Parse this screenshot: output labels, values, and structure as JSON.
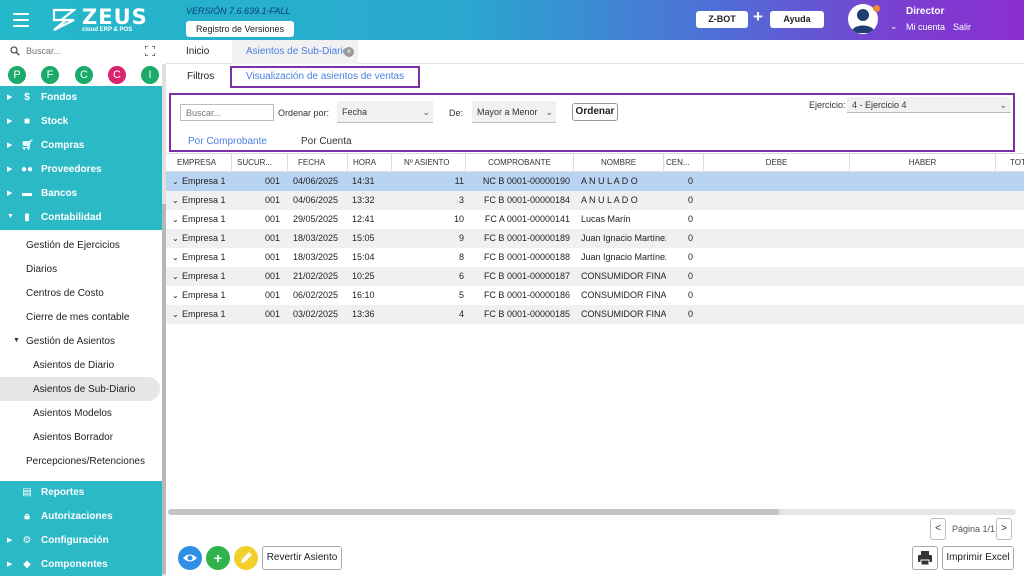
{
  "header": {
    "logo_text": "ZEUS",
    "logo_sub": "cloud ERP & POS",
    "version": "VERSIÓN 7.6.639.1-FALL",
    "registro_label": "Registro de Versiones",
    "zbot_label": "Z-BOT",
    "plus": "+",
    "ayuda_label": "Ayuda",
    "user_name": "Director",
    "mi_cuenta": "Mi cuenta",
    "salir": "Salir"
  },
  "sidebar": {
    "search_placeholder": "Buscar...",
    "quick": [
      {
        "letter": "P",
        "color": "#1aaa6a"
      },
      {
        "letter": "F",
        "color": "#1aaa6a"
      },
      {
        "letter": "C",
        "color": "#1aaa6a"
      },
      {
        "letter": "C",
        "color": "#d9236e"
      },
      {
        "letter": "I",
        "color": "#1aaa6a"
      }
    ],
    "nav_top": [
      {
        "label": "Fondos",
        "icon": "dollar-icon"
      },
      {
        "label": "Stock",
        "icon": "box-icon"
      },
      {
        "label": "Compras",
        "icon": "cart-icon"
      },
      {
        "label": "Proveedores",
        "icon": "people-icon"
      },
      {
        "label": "Bancos",
        "icon": "bank-icon"
      },
      {
        "label": "Contabilidad",
        "icon": "book-icon"
      }
    ],
    "sub_items": [
      "Gestión de Ejercicios",
      "Diarios",
      "Centros de Costo",
      "Cierre de mes contable",
      "Gestión de Asientos",
      "Asientos de Diario",
      "Asientos de Sub-Diario",
      "Asientos Modelos",
      "Asientos Borrador",
      "Percepciones/Retenciones"
    ],
    "nav_bottom": [
      {
        "label": "Reportes",
        "icon": "report-icon"
      },
      {
        "label": "Autorizaciones",
        "icon": "lock-icon"
      },
      {
        "label": "Configuración",
        "icon": "gear-icon"
      },
      {
        "label": "Componentes",
        "icon": "component-icon"
      }
    ]
  },
  "tabs": {
    "inicio": "Inicio",
    "asientos": "Asientos de Sub-Diario"
  },
  "subtabs": {
    "filtros": "Filtros",
    "visualizacion": "Visualización de asientos de ventas"
  },
  "filters": {
    "search_placeholder": "Buscar...",
    "ordenar_por_label": "Ordenar por:",
    "ordenar_por_value": "Fecha",
    "de_label": "De:",
    "de_value": "Mayor a Menor",
    "ordenar_button": "Ordenar",
    "ejercicio_label": "Ejercicio:",
    "ejercicio_value": "4 - Ejercicio 4",
    "view_comprobante": "Por Comprobante",
    "view_cuenta": "Por Cuenta"
  },
  "table": {
    "headers": [
      "EMPRESA",
      "SUCUR...",
      "FECHA",
      "HORA",
      "Nº ASIENTO",
      "COMPROBANTE",
      "NOMBRE",
      "CEN...",
      "DEBE",
      "HABER",
      "TOT"
    ],
    "rows": [
      {
        "empresa": "Empresa 1",
        "sucursal": "001",
        "fecha": "04/06/2025",
        "hora": "14:31",
        "asiento": "11",
        "comprobante": "NC B 0001-00000190",
        "nombre": "A N U L A D O",
        "centro": "0"
      },
      {
        "empresa": "Empresa 1",
        "sucursal": "001",
        "fecha": "04/06/2025",
        "hora": "13:32",
        "asiento": "3",
        "comprobante": "FC B 0001-00000184",
        "nombre": "A N U L A D O",
        "centro": "0"
      },
      {
        "empresa": "Empresa 1",
        "sucursal": "001",
        "fecha": "29/05/2025",
        "hora": "12:41",
        "asiento": "10",
        "comprobante": "FC A 0001-00000141",
        "nombre": "Lucas Marín",
        "centro": "0"
      },
      {
        "empresa": "Empresa 1",
        "sucursal": "001",
        "fecha": "18/03/2025",
        "hora": "15:05",
        "asiento": "9",
        "comprobante": "FC B 0001-00000189",
        "nombre": "Juan Ignacio Martínez",
        "centro": "0"
      },
      {
        "empresa": "Empresa 1",
        "sucursal": "001",
        "fecha": "18/03/2025",
        "hora": "15:04",
        "asiento": "8",
        "comprobante": "FC B 0001-00000188",
        "nombre": "Juan Ignacio Martínez",
        "centro": "0"
      },
      {
        "empresa": "Empresa 1",
        "sucursal": "001",
        "fecha": "21/02/2025",
        "hora": "10:25",
        "asiento": "6",
        "comprobante": "FC B 0001-00000187",
        "nombre": "CONSUMIDOR FINAL",
        "centro": "0"
      },
      {
        "empresa": "Empresa 1",
        "sucursal": "001",
        "fecha": "06/02/2025",
        "hora": "16:10",
        "asiento": "5",
        "comprobante": "FC B 0001-00000186",
        "nombre": "CONSUMIDOR FINAL",
        "centro": "0"
      },
      {
        "empresa": "Empresa 1",
        "sucursal": "001",
        "fecha": "03/02/2025",
        "hora": "13:36",
        "asiento": "4",
        "comprobante": "FC B 0001-00000185",
        "nombre": "CONSUMIDOR FINAL",
        "centro": "0"
      }
    ]
  },
  "pager": {
    "prev": "<",
    "text": "Página 1/1",
    "next": ">"
  },
  "actions": {
    "revertir": "Revertir Asiento",
    "imprimir_excel": "Imprimir Excel"
  },
  "colors": {
    "teal": "#2cb9c6",
    "accent_blue": "#4a7fe0",
    "highlight_purple": "#7b2fa8",
    "selected_row": "#b9d3f3"
  }
}
